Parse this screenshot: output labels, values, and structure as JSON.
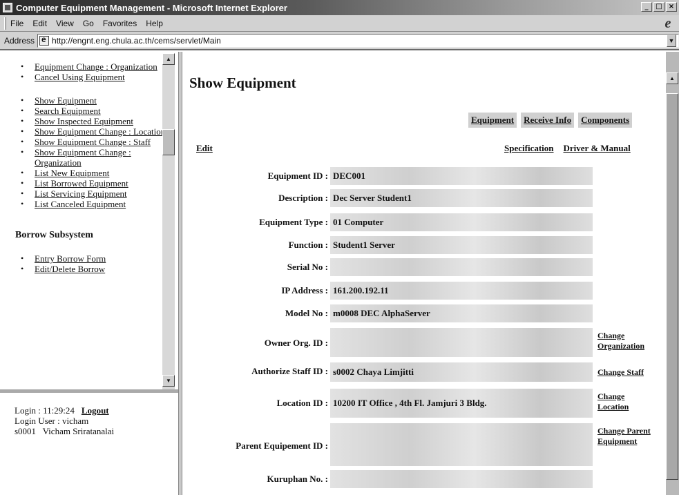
{
  "window": {
    "title": "Computer Equipment Management - Microsoft Internet Explorer"
  },
  "menu": [
    "File",
    "Edit",
    "View",
    "Go",
    "Favorites",
    "Help"
  ],
  "address": {
    "label": "Address",
    "url": "http://engnt.eng.chula.ac.th/cems/servlet/Main"
  },
  "sidebar": {
    "items_top": [
      "Equipment Change : Organization",
      "Cancel Using Equipment"
    ],
    "items_show": [
      "Show Equipment",
      "Search Equipment",
      "Show Inspected Equipment",
      "Show Equipment Change : Location",
      "Show Equipment Change : Staff",
      "Show Equipment Change : Organization",
      "List New Equipment",
      "List Borrowed Equipment",
      "List Servicing Equipment",
      "List Canceled Equipment"
    ],
    "borrow_title": "Borrow Subsystem",
    "items_borrow": [
      "Entry Borrow Form",
      "Edit/Delete Borrow"
    ]
  },
  "login": {
    "time_label": "Login : 11:29:24",
    "logout": "Logout",
    "user_label": "Login User : vicham",
    "user_name": "s0001   Vicham Sriratanalai"
  },
  "main": {
    "title": "Show Equipment",
    "tabs": [
      "Equipment",
      "Receive Info",
      "Components"
    ],
    "edit": "Edit",
    "specification": "Specification",
    "driver_manual": "Driver & Manual",
    "fields": [
      {
        "label": "Equipment ID :",
        "value": "DEC001",
        "action": ""
      },
      {
        "label": "Description :",
        "value": "Dec Server Student1",
        "action": ""
      },
      {
        "label": "Equipment Type :",
        "value": "01 Computer",
        "action": ""
      },
      {
        "label": "Function :",
        "value": "Student1 Server",
        "action": ""
      },
      {
        "label": "Serial No :",
        "value": "",
        "action": ""
      },
      {
        "label": "IP Address :",
        "value": "161.200.192.11",
        "action": ""
      },
      {
        "label": "Model No :",
        "value": "m0008 DEC AlphaServer",
        "action": ""
      },
      {
        "label": "Owner Org. ID :",
        "value": "",
        "action": "Change Organization"
      },
      {
        "label": "Authorize Staff ID :",
        "value": "s0002 Chaya Limjitti",
        "action": "Change Staff"
      },
      {
        "label": "Location ID :",
        "value": "10200 IT Office , 4th Fl. Jamjuri 3 Bldg.",
        "action": "Change Location"
      },
      {
        "label": "Parent Equipement ID :",
        "value": "",
        "action": "Change Parent Equipment"
      },
      {
        "label": "Kuruphan No. :",
        "value": "",
        "action": ""
      }
    ]
  }
}
